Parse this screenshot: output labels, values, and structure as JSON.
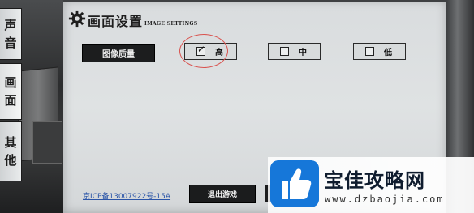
{
  "side_tabs": [
    {
      "label_line1": "声",
      "label_line2": "音"
    },
    {
      "label_line1": "画",
      "label_line2": "面"
    },
    {
      "label_line1": "其",
      "label_line2": "他"
    }
  ],
  "panel": {
    "title": "画面设置",
    "subtitle": "IMAGE SETTINGS",
    "quality_label": "图像质量",
    "options": [
      {
        "label": "高",
        "checked": true
      },
      {
        "label": "中",
        "checked": false
      },
      {
        "label": "低",
        "checked": false
      }
    ],
    "check_mark": "✓"
  },
  "footer": {
    "icp": "京ICP备13007922号-15A",
    "exit_button": "退出游戏"
  },
  "watermark": {
    "title": "宝佳攻略网",
    "url": "www.dzbaojia.com"
  },
  "colors": {
    "annotation_circle": "#d9534f",
    "watermark_blue": "#1677d9",
    "icp_link": "#2b55a8"
  }
}
